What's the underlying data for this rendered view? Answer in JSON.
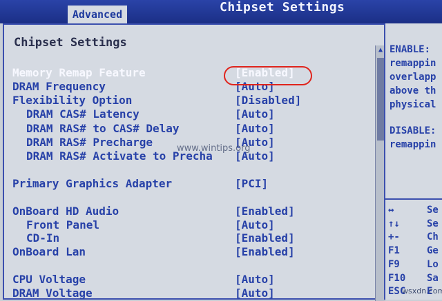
{
  "header": {
    "tab": "Advanced",
    "title": "Chipset Settings"
  },
  "main": {
    "title": "Chipset Settings",
    "rows": [
      {
        "label": "Memory Remap Feature",
        "value": "[Enabled]"
      },
      {
        "label": "DRAM Frequency",
        "value": "[Auto]"
      },
      {
        "label": "Flexibility Option",
        "value": "[Disabled]"
      },
      {
        "label": "DRAM CAS# Latency",
        "value": "[Auto]"
      },
      {
        "label": "DRAM RAS# to CAS# Delay",
        "value": "[Auto]"
      },
      {
        "label": "DRAM RAS# Precharge",
        "value": "[Auto]"
      },
      {
        "label": "DRAM RAS# Activate to Precha",
        "value": "[Auto]"
      },
      {
        "label": "Primary Graphics Adapter",
        "value": "[PCI]"
      },
      {
        "label": "OnBoard HD Audio",
        "value": "[Enabled]"
      },
      {
        "label": "Front Panel",
        "value": "[Auto]"
      },
      {
        "label": "CD-In",
        "value": "[Enabled]"
      },
      {
        "label": "OnBoard Lan",
        "value": "[Enabled]"
      },
      {
        "label": "CPU Voltage",
        "value": "[Auto]"
      },
      {
        "label": "DRAM Voltage",
        "value": "[Auto]"
      }
    ]
  },
  "help": {
    "lines": [
      "ENABLE:",
      "remappin",
      "overlapp",
      "above th",
      "physical",
      "DISABLE:",
      "remappin"
    ],
    "keys": [
      {
        "key": "↔",
        "desc": "Se"
      },
      {
        "key": "↑↓",
        "desc": "Se"
      },
      {
        "key": "+-",
        "desc": "Ch"
      },
      {
        "key": "F1",
        "desc": "Ge"
      },
      {
        "key": "F9",
        "desc": "Lo"
      },
      {
        "key": "F10",
        "desc": "Sa"
      },
      {
        "key": "ESC",
        "desc": "E"
      }
    ]
  },
  "watermark": "www.wintips.org",
  "corner_mark": "wsxdn.com"
}
